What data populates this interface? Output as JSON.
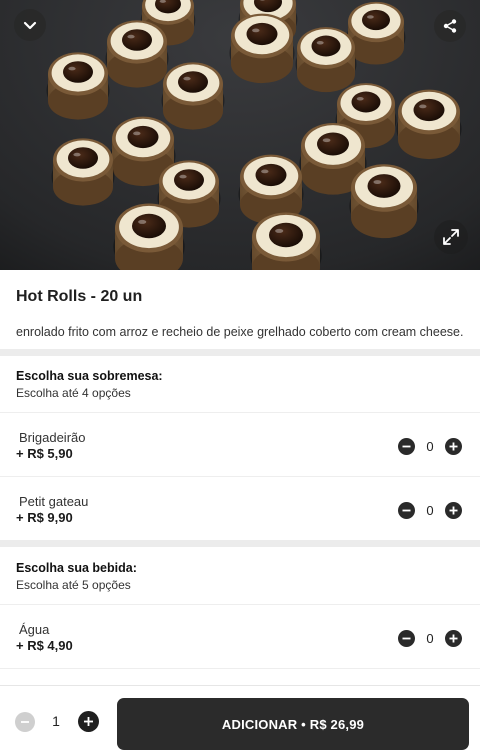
{
  "product": {
    "title": "Hot Rolls - 20 un",
    "description": "enrolado frito com arroz e recheio de peixe grelhado coberto com cream cheese."
  },
  "groups": [
    {
      "title": "Escolha sua sobremesa:",
      "subtitle": "Escolha até 4 opções",
      "options": [
        {
          "name": "Brigadeirão",
          "price": "+ R$ 5,90",
          "qty": "0"
        },
        {
          "name": "Petit gateau",
          "price": "+ R$ 9,90",
          "qty": "0"
        }
      ]
    },
    {
      "title": "Escolha sua bebida:",
      "subtitle": "Escolha até 5 opções",
      "options": [
        {
          "name": "Água",
          "price": "+ R$ 4,90",
          "qty": "0"
        }
      ]
    }
  ],
  "footer": {
    "qty": "1",
    "add_label": "ADICIONAR • R$ 26,99"
  },
  "icons": {
    "back": "chevron-down-icon",
    "share": "share-icon",
    "expand": "expand-icon",
    "minus": "minus-icon",
    "plus": "plus-icon"
  },
  "colors": {
    "button_dark": "#2b2b2b",
    "separator": "#ececec",
    "disabled": "#cfcfcf"
  }
}
